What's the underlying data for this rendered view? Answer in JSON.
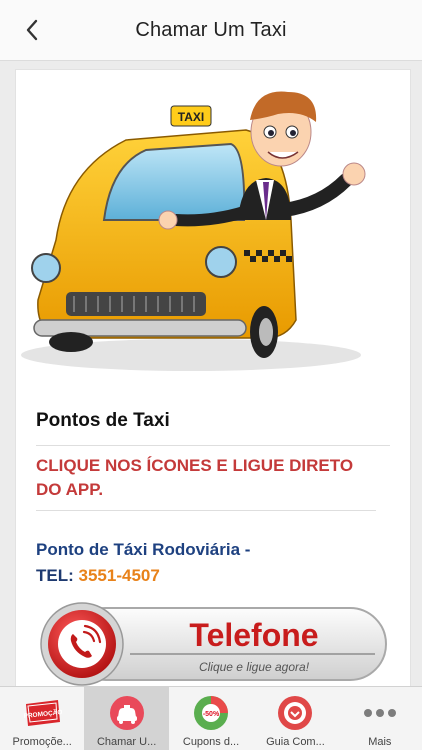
{
  "header": {
    "title": "Chamar Um Taxi"
  },
  "hero": {
    "sign_text": "TAXI"
  },
  "section": {
    "title": "Pontos de Taxi",
    "instruction": "CLIQUE NOS ÍCONES E LIGUE DIRETO DO APP.",
    "point_name": "Ponto de Táxi Rodoviária -",
    "tel_label": "TEL:",
    "tel_number": "3551-4507"
  },
  "phone_button": {
    "label": "Telefone",
    "subtitle": "Clique e ligue agora!"
  },
  "tabs": [
    {
      "label": "Promoçõe...",
      "icon": "promo-badge-icon",
      "badge_text": "PROMOÇÃO"
    },
    {
      "label": "Chamar U...",
      "icon": "taxi-icon"
    },
    {
      "label": "Cupons d...",
      "icon": "coupon-icon",
      "badge_text": "-50%"
    },
    {
      "label": "Guia Com...",
      "icon": "guide-icon"
    },
    {
      "label": "Mais",
      "icon": "more-icon"
    }
  ],
  "colors": {
    "accent_red": "#c43a3a",
    "point_blue": "#1e4180",
    "tel_orange": "#e8821a",
    "active_tab": "#d3d3d3"
  }
}
